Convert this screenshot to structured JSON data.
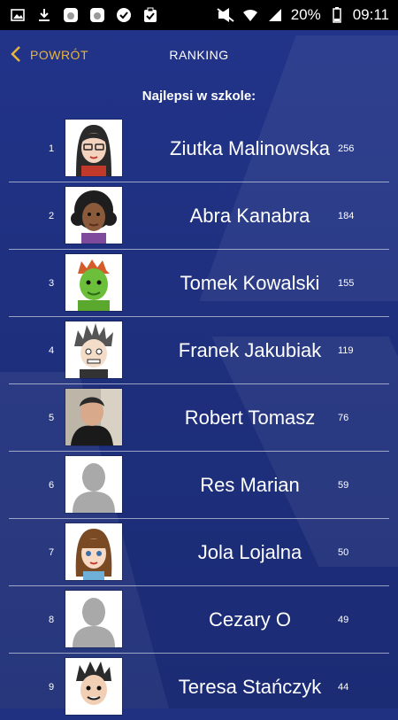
{
  "status_bar": {
    "battery": "20%",
    "time": "09:11",
    "left_icons": [
      "image-icon",
      "download-icon",
      "nadir-icon",
      "nadir-icon",
      "check-icon",
      "clipboard-icon"
    ],
    "right_icons": [
      "mute-icon",
      "wifi-icon",
      "signal-icon",
      "battery-icon"
    ]
  },
  "header": {
    "back_label": "POWRÓT",
    "title": "RANKING",
    "accent": "#e9b53a"
  },
  "subtitle": "Najlepsi w szkole:",
  "ranking": [
    {
      "rank": "1",
      "name": "Ziutka Malinowska",
      "score": "256",
      "avatar": "avatar-woman-glasses"
    },
    {
      "rank": "2",
      "name": "Abra Kanabra",
      "score": "184",
      "avatar": "avatar-curly-hair"
    },
    {
      "rank": "3",
      "name": "Tomek Kowalski",
      "score": "155",
      "avatar": "avatar-green-face"
    },
    {
      "rank": "4",
      "name": "Franek Jakubiak",
      "score": "119",
      "avatar": "avatar-spiky-hair"
    },
    {
      "rank": "5",
      "name": "Robert Tomasz",
      "score": "76",
      "avatar": "avatar-photo"
    },
    {
      "rank": "6",
      "name": "Res Marian",
      "score": "59",
      "avatar": "avatar-placeholder"
    },
    {
      "rank": "7",
      "name": "Jola Lojalna",
      "score": "50",
      "avatar": "avatar-girl-bangs"
    },
    {
      "rank": "8",
      "name": "Cezary O",
      "score": "49",
      "avatar": "avatar-placeholder"
    },
    {
      "rank": "9",
      "name": "Teresa Stańczyk",
      "score": "44",
      "avatar": "avatar-boy-spiky"
    }
  ]
}
